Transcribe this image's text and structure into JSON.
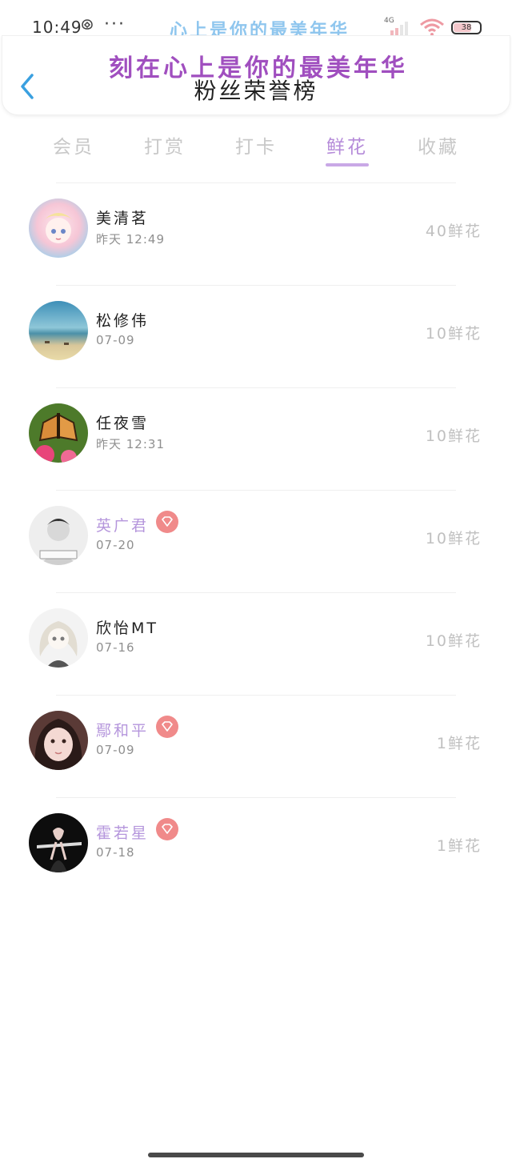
{
  "status_bar": {
    "time": "10:49",
    "more": "···",
    "marquee": "心上是你的最美年华",
    "network": "4G",
    "battery": "38"
  },
  "header": {
    "watermark": "刻在心上是你的最美年华",
    "title": "粉丝荣誉榜"
  },
  "tabs": [
    {
      "label": "会员",
      "active": false
    },
    {
      "label": "打赏",
      "active": false
    },
    {
      "label": "打卡",
      "active": false
    },
    {
      "label": "鲜花",
      "active": true
    },
    {
      "label": "收藏",
      "active": false
    }
  ],
  "colors": {
    "accent": "#b58bd9",
    "vip_name": "#b596dc",
    "vip_badge": "#f08a8a",
    "back_arrow": "#3aa0e0"
  },
  "rows": [
    {
      "name": "美清茗",
      "time": "昨天 12:49",
      "amount": "40鲜花",
      "vip": false,
      "avatar_icon": "anime-girl-avatar"
    },
    {
      "name": "松修伟",
      "time": "07-09",
      "amount": "10鲜花",
      "vip": false,
      "avatar_icon": "beach-avatar"
    },
    {
      "name": "任夜雪",
      "time": "昨天 12:31",
      "amount": "10鲜花",
      "vip": false,
      "avatar_icon": "butterfly-avatar"
    },
    {
      "name": "英广君",
      "time": "07-20",
      "amount": "10鲜花",
      "vip": true,
      "avatar_icon": "boy-photo-avatar"
    },
    {
      "name": "欣怡MT",
      "time": "07-16",
      "amount": "10鲜花",
      "vip": false,
      "avatar_icon": "anime-sketch-avatar"
    },
    {
      "name": "鄢和平",
      "time": "07-09",
      "amount": "1鲜花",
      "vip": true,
      "avatar_icon": "girl-photo-avatar"
    },
    {
      "name": "霍若星",
      "time": "07-18",
      "amount": "1鲜花",
      "vip": true,
      "avatar_icon": "dark-portrait-avatar"
    }
  ]
}
